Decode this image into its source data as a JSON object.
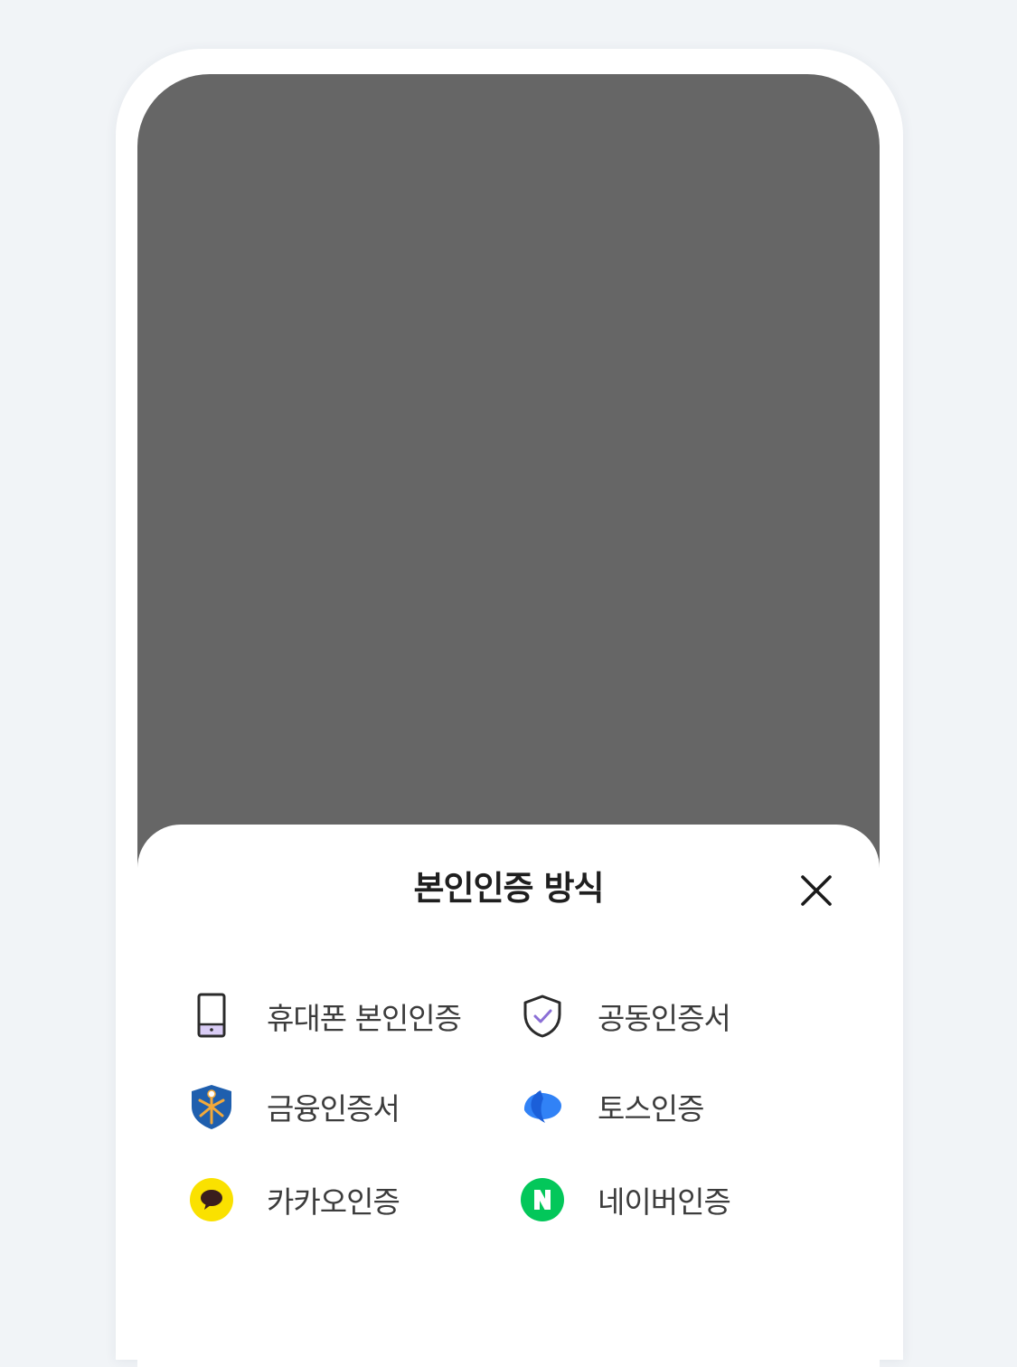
{
  "sheet": {
    "title": "본인인증 방식",
    "close_icon": "close-icon"
  },
  "options": [
    {
      "label": "휴대폰 본인인증",
      "icon": "phone-icon"
    },
    {
      "label": "공동인증서",
      "icon": "shield-check-icon"
    },
    {
      "label": "금융인증서",
      "icon": "finance-cert-icon"
    },
    {
      "label": "토스인증",
      "icon": "toss-icon"
    },
    {
      "label": "카카오인증",
      "icon": "kakao-icon"
    },
    {
      "label": "네이버인증",
      "icon": "naver-icon"
    }
  ],
  "colors": {
    "page_background": "#f1f4f7",
    "overlay": "#666666",
    "sheet_background": "#ffffff",
    "kakao_yellow": "#fae100",
    "naver_green": "#03c75a",
    "toss_blue": "#3182f6",
    "accent_purple": "#8b6fd6"
  }
}
